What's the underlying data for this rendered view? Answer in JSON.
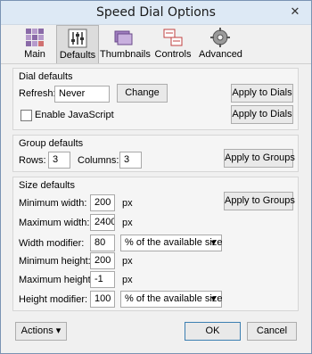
{
  "window": {
    "title": "Speed Dial Options",
    "close_glyph": "✕"
  },
  "tabs": [
    {
      "label": "Main",
      "icon": "grid-icon"
    },
    {
      "label": "Defaults",
      "icon": "sliders-icon"
    },
    {
      "label": "Thumbnails",
      "icon": "thumbnails-icon"
    },
    {
      "label": "Controls",
      "icon": "controls-icon"
    },
    {
      "label": "Advanced",
      "icon": "gear-icon"
    }
  ],
  "dial_defaults": {
    "title": "Dial defaults",
    "refresh_label": "Refresh:",
    "refresh_value": "Never",
    "change_button": "Change",
    "apply_button_1": "Apply to Dials",
    "enable_js_label": "Enable JavaScript",
    "enable_js_checked": false,
    "apply_button_2": "Apply to Dials"
  },
  "group_defaults": {
    "title": "Group defaults",
    "rows_label": "Rows:",
    "rows_value": "3",
    "columns_label": "Columns:",
    "columns_value": "3",
    "apply_button": "Apply to Groups"
  },
  "size_defaults": {
    "title": "Size defaults",
    "min_width_label": "Minimum width:",
    "min_width_value": "200",
    "max_width_label": "Maximum width:",
    "max_width_value": "2400",
    "width_mod_label": "Width modifier:",
    "width_mod_value": "80",
    "width_mod_select": "% of the available size",
    "min_height_label": "Minimum height:",
    "min_height_value": "200",
    "max_height_label": "Maximum height:",
    "max_height_value": "-1",
    "height_mod_label": "Height modifier:",
    "height_mod_value": "100",
    "height_mod_select": "% of the available size",
    "unit": "px",
    "apply_button": "Apply to Groups"
  },
  "footer": {
    "actions_button": "Actions",
    "actions_arrow": "▾",
    "ok_button": "OK",
    "cancel_button": "Cancel"
  },
  "colors": {
    "active_tab_bg": "#dcdcdc",
    "titlebar_bg": "#dde9f5",
    "ok_border": "#3c7fb1"
  }
}
